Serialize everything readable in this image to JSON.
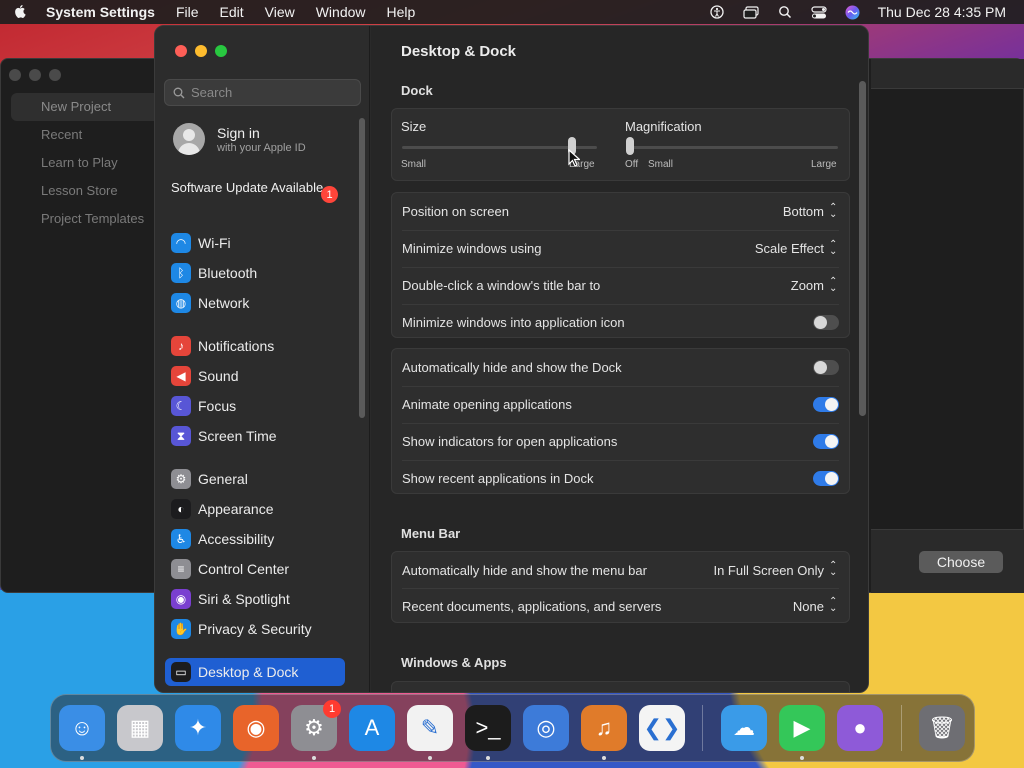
{
  "menubar": {
    "app_name": "System Settings",
    "items": [
      "File",
      "Edit",
      "View",
      "Window",
      "Help"
    ],
    "clock": "Thu Dec 28  4:35 PM"
  },
  "background_window": {
    "sidebar_items": [
      "New Project",
      "Recent",
      "Learn to Play",
      "Lesson Store",
      "Project Templates"
    ],
    "choose_label": "Choose"
  },
  "sidebar": {
    "search_placeholder": "Search",
    "account_title": "Sign in",
    "account_subtitle": "with your Apple ID",
    "update_label": "Software Update Available",
    "update_badge": "1",
    "items": [
      {
        "label": "Wi-Fi",
        "icon": "wifi-icon",
        "color": "#1e88e5"
      },
      {
        "label": "Bluetooth",
        "icon": "bluetooth-icon",
        "color": "#1e88e5"
      },
      {
        "label": "Network",
        "icon": "globe-icon",
        "color": "#1e88e5"
      },
      {
        "label": "Notifications",
        "icon": "bell-icon",
        "color": "#e5453a"
      },
      {
        "label": "Sound",
        "icon": "speaker-icon",
        "color": "#e5453a"
      },
      {
        "label": "Focus",
        "icon": "moon-icon",
        "color": "#5856d6"
      },
      {
        "label": "Screen Time",
        "icon": "hourglass-icon",
        "color": "#5856d6"
      },
      {
        "label": "General",
        "icon": "gear-icon",
        "color": "#8e8e93"
      },
      {
        "label": "Appearance",
        "icon": "appearance-icon",
        "color": "#1c1c1e"
      },
      {
        "label": "Accessibility",
        "icon": "accessibility-icon",
        "color": "#1e88e5"
      },
      {
        "label": "Control Center",
        "icon": "control-center-icon",
        "color": "#8e8e93"
      },
      {
        "label": "Siri & Spotlight",
        "icon": "siri-icon",
        "color": "#7a3fd0"
      },
      {
        "label": "Privacy & Security",
        "icon": "hand-icon",
        "color": "#1e88e5"
      },
      {
        "label": "Desktop & Dock",
        "icon": "dock-icon",
        "color": "#1c1c1e"
      }
    ]
  },
  "main": {
    "title": "Desktop & Dock",
    "dock_section": "Dock",
    "size": {
      "label": "Size",
      "min_label": "Small",
      "max_label": "Large",
      "value": 0.87
    },
    "magnification": {
      "label": "Magnification",
      "off_label": "Off",
      "min_label": "Small",
      "max_label": "Large",
      "value": 0.0
    },
    "position_rows": [
      {
        "label": "Position on screen",
        "value": "Bottom"
      },
      {
        "label": "Minimize windows using",
        "value": "Scale Effect"
      },
      {
        "label": "Double-click a window's title bar to",
        "value": "Zoom"
      }
    ],
    "minimize_into_icon": {
      "label": "Minimize windows into application icon",
      "on": false
    },
    "toggles": [
      {
        "label": "Automatically hide and show the Dock",
        "on": false
      },
      {
        "label": "Animate opening applications",
        "on": true
      },
      {
        "label": "Show indicators for open applications",
        "on": true
      },
      {
        "label": "Show recent applications in Dock",
        "on": true
      }
    ],
    "menubar_section": "Menu Bar",
    "menubar_rows": [
      {
        "label": "Automatically hide and show the menu bar",
        "value": "In Full Screen Only"
      },
      {
        "label": "Recent documents, applications, and servers",
        "value": "None"
      }
    ],
    "windows_section": "Windows & Apps"
  },
  "dock": {
    "apps": [
      {
        "name": "finder-icon",
        "color": "#3a8ee6",
        "glyph": "☺"
      },
      {
        "name": "launchpad-icon",
        "color": "#c8c8cc",
        "glyph": "▦"
      },
      {
        "name": "safari-icon",
        "color": "#2f8ae8",
        "glyph": "✦"
      },
      {
        "name": "firefox-icon",
        "color": "#e8642a",
        "glyph": "◉"
      },
      {
        "name": "system-settings-icon",
        "color": "#8e8e93",
        "glyph": "⚙"
      },
      {
        "name": "app-store-icon",
        "color": "#1e88e5",
        "glyph": "A"
      },
      {
        "name": "textedit-icon",
        "color": "#f2f2f2",
        "glyph": "✎"
      },
      {
        "name": "terminal-icon",
        "color": "#1c1c1c",
        "glyph": ">_"
      },
      {
        "name": "browser-icon",
        "color": "#3d7bd9",
        "glyph": "◎"
      },
      {
        "name": "garageband-icon",
        "color": "#e07b2a",
        "glyph": "♫"
      },
      {
        "name": "vscode-icon",
        "color": "#f4f4f4",
        "glyph": "❮❯"
      },
      {
        "name": "weather-icon",
        "color": "#3a9be8",
        "glyph": "☁"
      },
      {
        "name": "facetime-icon",
        "color": "#34c759",
        "glyph": "▶"
      },
      {
        "name": "sonoma-installer-icon",
        "color": "#8e5ad8",
        "glyph": "●"
      },
      {
        "name": "trash-icon",
        "color": "#6e6e73",
        "glyph": "🗑"
      }
    ],
    "settings_badge": "1"
  }
}
